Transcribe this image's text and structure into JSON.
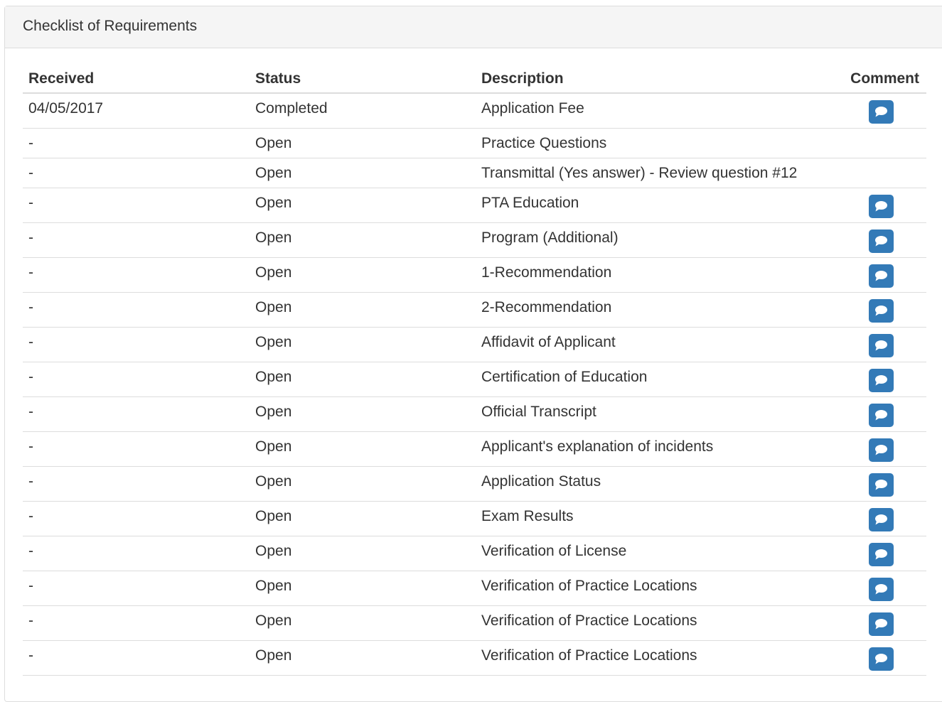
{
  "panel": {
    "title": "Checklist of Requirements"
  },
  "table": {
    "headers": {
      "received": "Received",
      "status": "Status",
      "description": "Description",
      "comment": "Comment"
    },
    "rows": [
      {
        "received": "04/05/2017",
        "status": "Completed",
        "description": "Application Fee",
        "has_comment": true
      },
      {
        "received": "-",
        "status": "Open",
        "description": "Practice Questions",
        "has_comment": false
      },
      {
        "received": "-",
        "status": "Open",
        "description": "Transmittal (Yes answer) - Review question #12",
        "has_comment": false
      },
      {
        "received": "-",
        "status": "Open",
        "description": "PTA Education",
        "has_comment": true
      },
      {
        "received": "-",
        "status": "Open",
        "description": "Program (Additional)",
        "has_comment": true
      },
      {
        "received": "-",
        "status": "Open",
        "description": "1-Recommendation",
        "has_comment": true
      },
      {
        "received": "-",
        "status": "Open",
        "description": "2-Recommendation",
        "has_comment": true
      },
      {
        "received": "-",
        "status": "Open",
        "description": "Affidavit of Applicant",
        "has_comment": true
      },
      {
        "received": "-",
        "status": "Open",
        "description": "Certification of Education",
        "has_comment": true
      },
      {
        "received": "-",
        "status": "Open",
        "description": "Official Transcript",
        "has_comment": true
      },
      {
        "received": "-",
        "status": "Open",
        "description": "Applicant's explanation of incidents",
        "has_comment": true
      },
      {
        "received": "-",
        "status": "Open",
        "description": "Application Status",
        "has_comment": true
      },
      {
        "received": "-",
        "status": "Open",
        "description": "Exam Results",
        "has_comment": true
      },
      {
        "received": "-",
        "status": "Open",
        "description": "Verification of License",
        "has_comment": true
      },
      {
        "received": "-",
        "status": "Open",
        "description": "Verification of Practice Locations",
        "has_comment": true
      },
      {
        "received": "-",
        "status": "Open",
        "description": "Verification of Practice Locations",
        "has_comment": true
      },
      {
        "received": "-",
        "status": "Open",
        "description": "Verification of Practice Locations",
        "has_comment": true
      }
    ],
    "comment_icon": "comment-icon"
  },
  "colors": {
    "button_bg": "#337ab7",
    "border": "#dddddd",
    "heading_bg": "#f5f5f5",
    "text": "#333333"
  }
}
